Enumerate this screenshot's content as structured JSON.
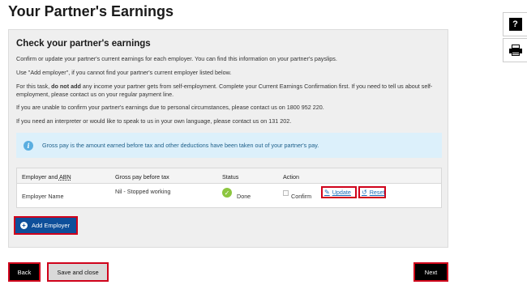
{
  "page": {
    "title": "Your Partner's Earnings"
  },
  "side": {
    "help_icon": "question-mark-icon",
    "print_icon": "print-icon",
    "help_glyph": "?"
  },
  "panel": {
    "title": "Check your partner's earnings",
    "p1": "Confirm or update your partner's current earnings for each employer. You can find this information on your partner's payslips.",
    "p2": "Use \"Add employer\", if you cannot find your partner's current employer listed below.",
    "p3_a": "For this task, ",
    "p3_b": "do not add",
    "p3_c": " any income your partner gets from self-employment. Complete your Current Earnings Confirmation first. If you need to tell us about self-employment, please contact us on your regular payment line.",
    "p4": "If you are unable to confirm your partner's earnings due to personal circumstances, please contact us on 1800 952 220.",
    "p5": "If you need an interpreter or would like to speak to us in your own language, please contact us on 131 202.",
    "info": "Gross pay is the amount earned before tax and other deductions have been taken out of your partner's pay."
  },
  "table": {
    "headers": {
      "employer": "Employer and ",
      "employer_abbr": "ABN",
      "gross": "Gross pay before tax",
      "status": "Status",
      "action": "Action"
    },
    "rows": [
      {
        "employer": "Employer Name",
        "gross": "Nil - Stopped working",
        "status": "Done",
        "confirm": "Confirm",
        "update": "Update",
        "reset": "Reset"
      }
    ]
  },
  "buttons": {
    "add_employer": "Add Employer",
    "back": "Back",
    "save_close": "Save and close",
    "next": "Next"
  },
  "colors": {
    "primary_blue": "#0e4f9a",
    "highlight_red": "#d0021b",
    "done_green": "#8cc63f",
    "info_bg": "#dcf0fb"
  }
}
